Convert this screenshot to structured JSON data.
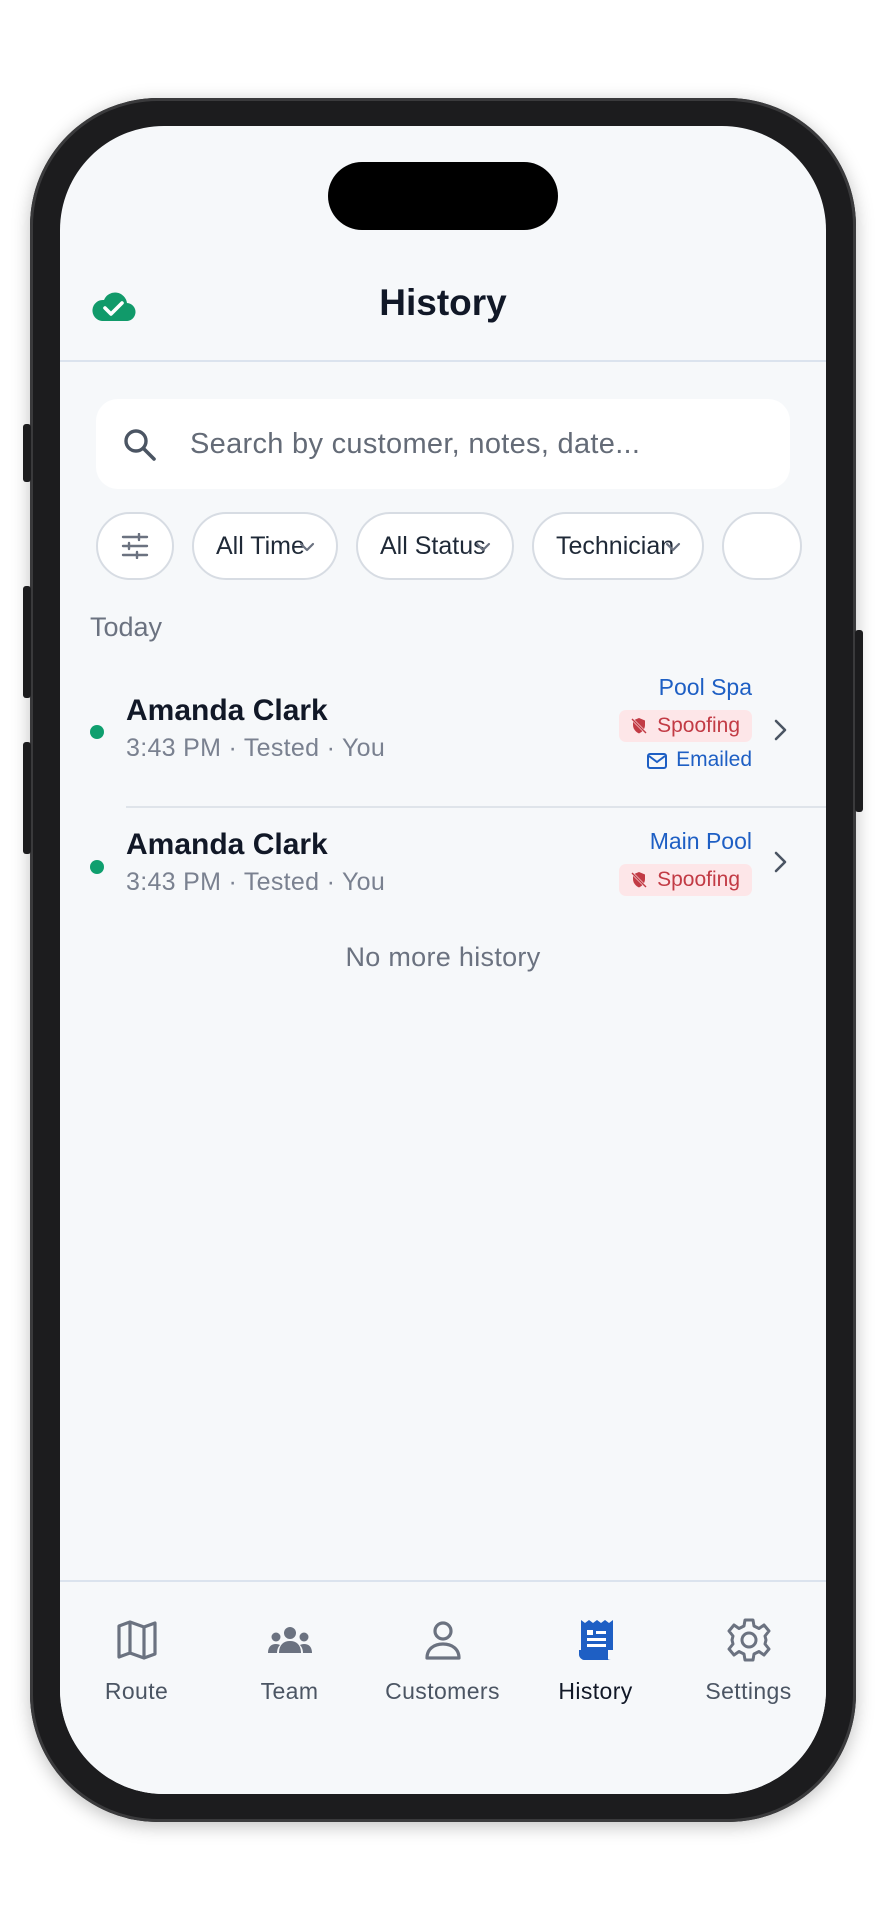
{
  "header": {
    "title": "History",
    "sync_icon": "cloud-check-icon"
  },
  "search": {
    "placeholder": "Search by customer, notes, date..."
  },
  "filters": [
    {
      "label": "All Time"
    },
    {
      "label": "All Status"
    },
    {
      "label": "Technician"
    }
  ],
  "section": {
    "label": "Today"
  },
  "items": [
    {
      "name": "Amanda Clark",
      "meta": "3:43 PM · Tested · You",
      "location": "Pool Spa",
      "badge": "Spoofing",
      "emailed": "Emailed",
      "status_color": "#0f9f6e"
    },
    {
      "name": "Amanda Clark",
      "meta": "3:43 PM · Tested · You",
      "location": "Main Pool",
      "badge": "Spoofing",
      "status_color": "#0f9f6e"
    }
  ],
  "footer_text": "No more history",
  "tabs": [
    {
      "label": "Route",
      "icon": "map-icon"
    },
    {
      "label": "Team",
      "icon": "team-icon"
    },
    {
      "label": "Customers",
      "icon": "person-icon"
    },
    {
      "label": "History",
      "icon": "receipt-icon",
      "active": true
    },
    {
      "label": "Settings",
      "icon": "gear-icon"
    }
  ],
  "colors": {
    "accent": "#1e5fc4",
    "success": "#0f9f6e",
    "danger": "#c23b45",
    "active_tab": "#1e5fc4"
  }
}
